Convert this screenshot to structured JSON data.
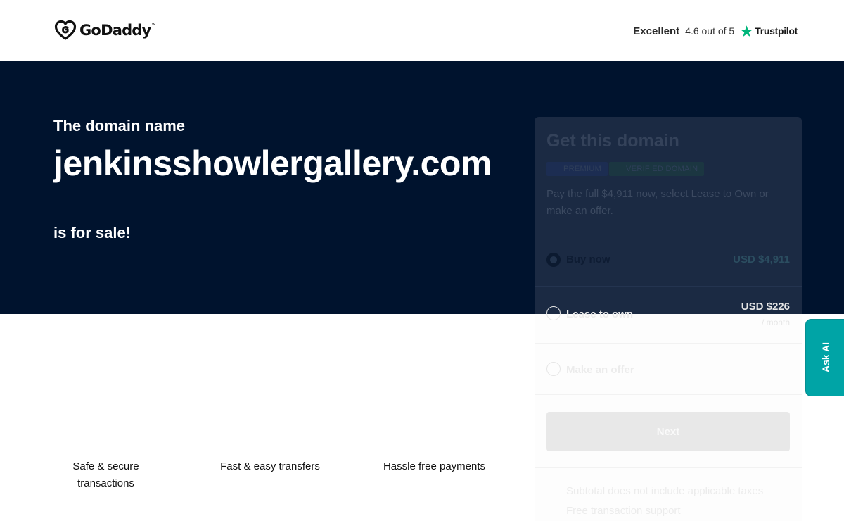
{
  "header": {
    "logo_text": "GoDaddy",
    "logo_tm": "™",
    "logo_icon": "godaddy-heart-logo",
    "rating": {
      "label": "Excellent",
      "score": "4.6 out of 5",
      "provider": "Trustpilot",
      "star_icon": "trustpilot-star-icon",
      "star_color": "#00b67a"
    }
  },
  "hero": {
    "intro": "The domain name",
    "domain": "jenkinsshowlergallery.com",
    "suffix": "is for sale!",
    "background": "#00132e"
  },
  "card": {
    "title": "Get this domain",
    "badges": [
      "PREMIUM",
      "VERIFIED DOMAIN"
    ],
    "description": "Pay the full $4,911 now, select Lease to Own or make an offer.",
    "options": [
      {
        "label": "Buy now",
        "price": "USD $4,911",
        "selected": true
      },
      {
        "label": "Lease to own",
        "price": "USD $226",
        "sub": "/ month",
        "selected": false
      },
      {
        "label": "Make an offer",
        "selected": false
      }
    ],
    "next_label": "Next",
    "footnotes": [
      "Subtotal does not include applicable taxes",
      "Free transaction support"
    ]
  },
  "benefits": [
    "Safe & secure transactions",
    "Fast & easy transfers",
    "Hassle free payments"
  ],
  "ask_ai": {
    "label": "Ask AI",
    "color": "#00a4a6"
  }
}
